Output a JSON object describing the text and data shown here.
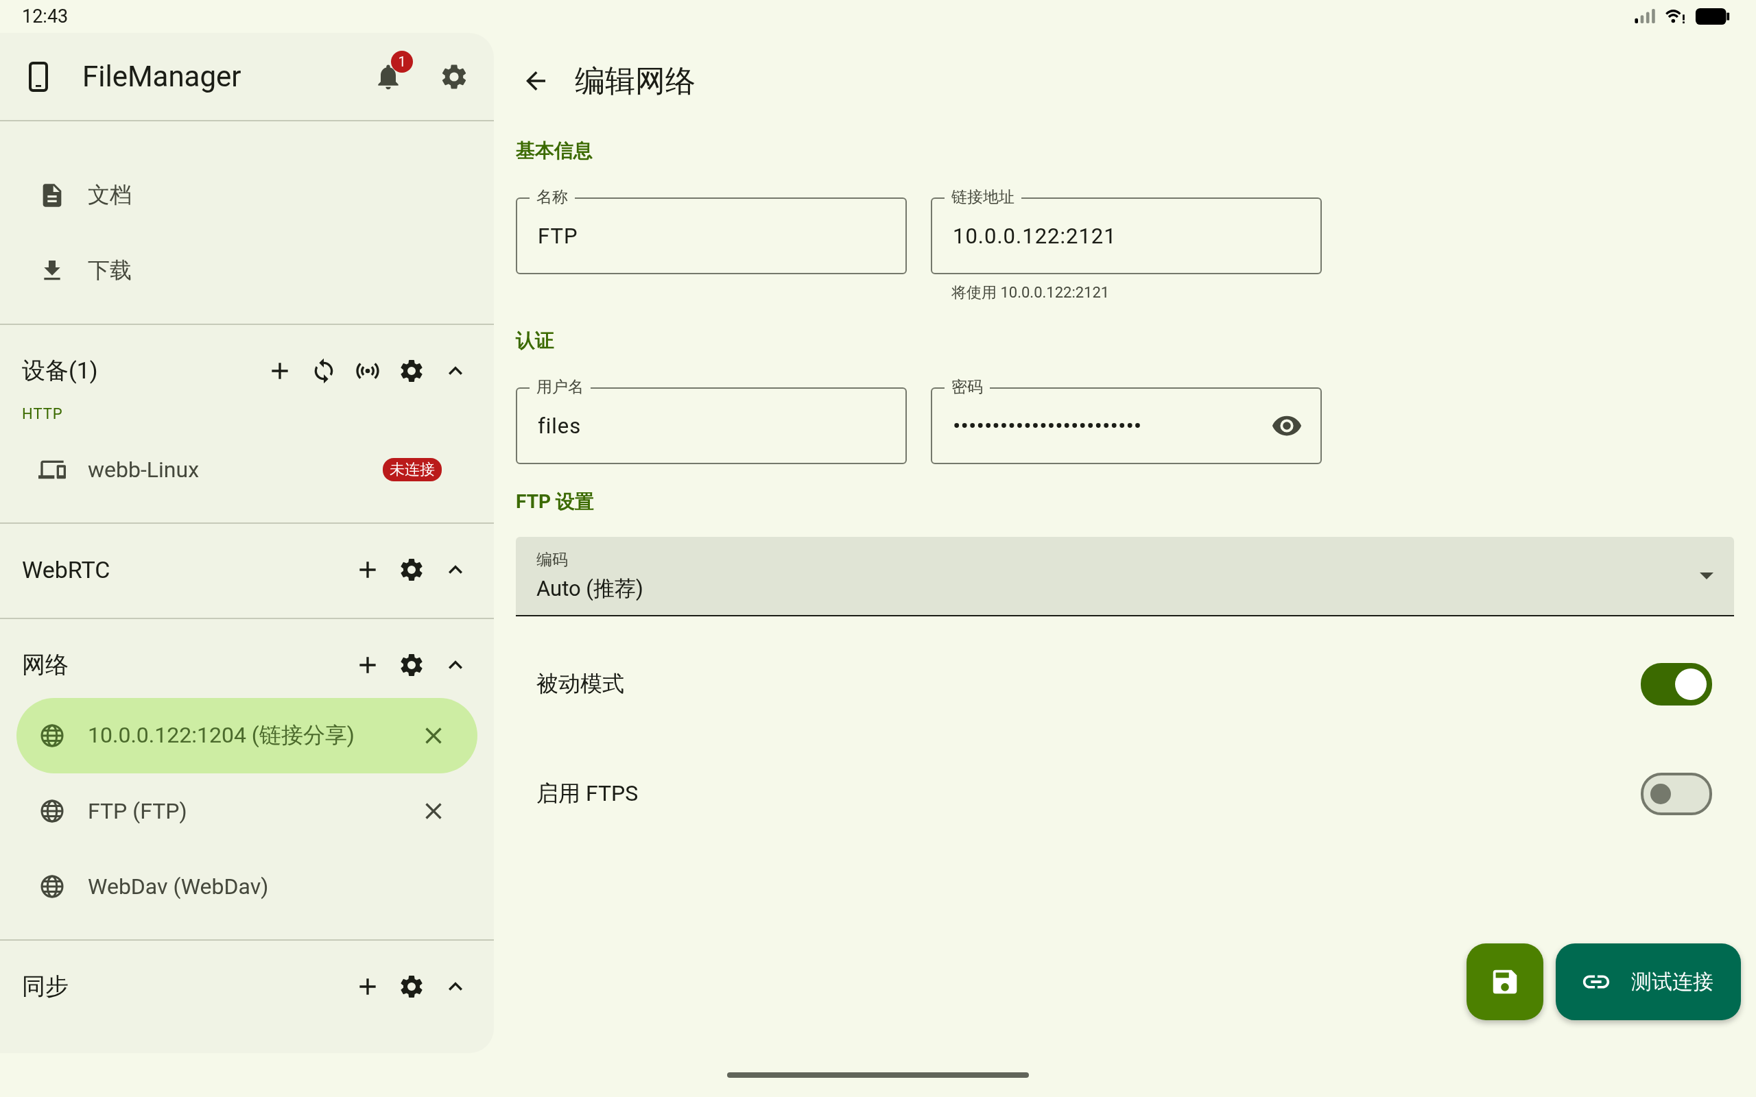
{
  "status_bar": {
    "time": "12:43"
  },
  "sidebar": {
    "app_title": "FileManager",
    "notification_count": "1",
    "items": [
      {
        "label": "文档",
        "kind": "document"
      },
      {
        "label": "下载",
        "kind": "download"
      }
    ],
    "sections": [
      {
        "title": "设备(1)",
        "kind": "devices",
        "subheader": "HTTP",
        "items": [
          {
            "label": "webb-Linux",
            "kind": "device",
            "badge": "未连接",
            "selected": false
          }
        ]
      },
      {
        "title": "WebRTC",
        "kind": "plain"
      },
      {
        "title": "网络",
        "kind": "plain",
        "items": [
          {
            "label": "10.0.0.122:1204 (链接分享)",
            "kind": "network",
            "selected": true,
            "removable": true
          },
          {
            "label": "FTP (FTP)",
            "kind": "network",
            "selected": false,
            "removable": true
          },
          {
            "label": "WebDav (WebDav)",
            "kind": "network",
            "selected": false,
            "removable": false
          }
        ]
      },
      {
        "title": "同步",
        "kind": "plain"
      }
    ]
  },
  "page": {
    "title": "编辑网络",
    "sections": [
      {
        "title": "基本信息",
        "kind": "fields",
        "fields": [
          {
            "label": "名称",
            "value": "FTP",
            "kind": "text"
          },
          {
            "label": "链接地址",
            "value": "10.0.0.122:2121",
            "kind": "text",
            "helper": "将使用 10.0.0.122:2121"
          }
        ]
      },
      {
        "title": "认证",
        "kind": "fields",
        "fields": [
          {
            "label": "用户名",
            "value": "files",
            "kind": "text"
          },
          {
            "label": "密码",
            "value": "••••••••••••••••••••••••",
            "kind": "password"
          }
        ]
      },
      {
        "title": "FTP 设置",
        "kind": "settings",
        "dropdown": {
          "label": "编码",
          "value": "Auto (推荐)"
        },
        "switches": [
          {
            "label": "被动模式",
            "on": true
          },
          {
            "label": "启用 FTPS",
            "on": false
          }
        ]
      }
    ]
  },
  "actions": {
    "test_button": "测试连接"
  }
}
